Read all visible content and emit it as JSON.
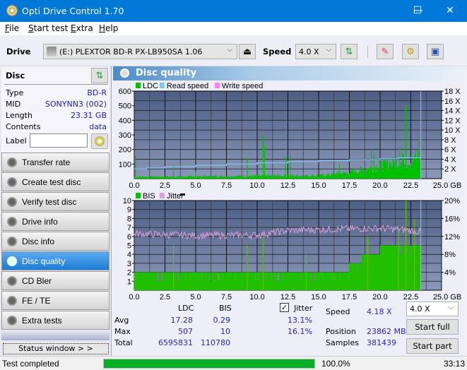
{
  "window": {
    "title": "Opti Drive Control 1.70",
    "minimize": "—",
    "maximize": "☐",
    "close": "✕"
  },
  "menu": [
    {
      "label": "File",
      "u": "F",
      "rest": "ile"
    },
    {
      "label": "Start test",
      "u": "S",
      "rest": "tart test"
    },
    {
      "label": "Extra",
      "u": "E",
      "rest": "xtra"
    },
    {
      "label": "Help",
      "u": "H",
      "rest": "elp"
    }
  ],
  "toolbar": {
    "drive_label": "Drive",
    "drive_value": "(E:)  PLEXTOR BD-R  PX-LB950SA 1.06",
    "speed_label": "Speed",
    "speed_value": "4.0 X"
  },
  "disc": {
    "title": "Disc",
    "rows": [
      {
        "k": "Type",
        "v": "BD-R"
      },
      {
        "k": "MID",
        "v": "SONYNN3 (002)"
      },
      {
        "k": "Length",
        "v": "23.31 GB"
      },
      {
        "k": "Contents",
        "v": "data"
      }
    ],
    "label_key": "Label",
    "label_value": ""
  },
  "nav": [
    {
      "label": "Transfer rate",
      "active": false
    },
    {
      "label": "Create test disc",
      "active": false
    },
    {
      "label": "Verify test disc",
      "active": false
    },
    {
      "label": "Drive info",
      "active": false
    },
    {
      "label": "Disc info",
      "active": false
    },
    {
      "label": "Disc quality",
      "active": true
    },
    {
      "label": "CD Bler",
      "active": false
    },
    {
      "label": "FE / TE",
      "active": false
    },
    {
      "label": "Extra tests",
      "active": false
    }
  ],
  "status_window_button": "Status window > >",
  "panel_title": "Disc quality",
  "colors": {
    "ldc": "#00c000",
    "read": "#7ec8f0",
    "write": "#ff80ff",
    "bis": "#00c000",
    "jitter": "#d8a0d8",
    "progress": "#06b025"
  },
  "chart_data": [
    {
      "type": "area",
      "legend": [
        "LDC",
        "Read speed",
        "Write speed"
      ],
      "x_ticks": [
        "0.0",
        "2.5",
        "5.0",
        "7.5",
        "10.0",
        "12.5",
        "15.0",
        "17.5",
        "20.0",
        "22.5",
        "25.0 GB"
      ],
      "y_ticks_left": [
        "600",
        "500",
        "400",
        "300",
        "200",
        "100"
      ],
      "y_ticks_right": [
        "18 X",
        "16 X",
        "14 X",
        "12 X",
        "10 X",
        "8 X",
        "6 X",
        "4 X",
        "2 X"
      ],
      "xlim": [
        0,
        25
      ],
      "ylim": [
        0,
        600
      ],
      "y2lim": [
        0,
        18
      ],
      "ldc_baseline": [
        [
          0,
          12
        ],
        [
          5,
          14
        ],
        [
          10,
          18
        ],
        [
          15,
          20
        ],
        [
          17.5,
          40
        ],
        [
          20,
          85
        ],
        [
          21.5,
          110
        ],
        [
          23.3,
          120
        ]
      ],
      "ldc_spikes": [
        [
          0.1,
          160
        ],
        [
          3.2,
          95
        ],
        [
          5.0,
          50
        ],
        [
          9.2,
          145
        ],
        [
          10.5,
          300
        ],
        [
          10.6,
          220
        ],
        [
          12.3,
          155
        ],
        [
          12.7,
          160
        ],
        [
          16.7,
          100
        ],
        [
          19.3,
          200
        ],
        [
          19.5,
          165
        ],
        [
          21.6,
          220
        ],
        [
          21.8,
          180
        ],
        [
          22.1,
          507
        ],
        [
          22.9,
          190
        ],
        [
          23.1,
          200
        ],
        [
          23.2,
          300
        ]
      ],
      "read_speed": [
        [
          0,
          2.0
        ],
        [
          1,
          2.2
        ],
        [
          2.5,
          2.45
        ],
        [
          5,
          2.75
        ],
        [
          7.5,
          3.0
        ],
        [
          10,
          3.25
        ],
        [
          12.5,
          3.5
        ],
        [
          15,
          3.7
        ],
        [
          17.5,
          3.9
        ],
        [
          20,
          4.1
        ],
        [
          21.5,
          4.3
        ],
        [
          23.3,
          4.3
        ]
      ],
      "end_position_gb": 23.31
    },
    {
      "type": "area",
      "legend": [
        "BIS",
        "Jitter"
      ],
      "x_ticks": [
        "0.0",
        "2.5",
        "5.0",
        "7.5",
        "10.0",
        "12.5",
        "15.0",
        "17.5",
        "20.0",
        "22.5",
        "25.0 GB"
      ],
      "y_ticks_left": [
        "10",
        "9",
        "8",
        "7",
        "6",
        "5",
        "4",
        "3",
        "2",
        "1"
      ],
      "y_ticks_right": [
        "20%",
        "16%",
        "12%",
        "8%",
        "4%"
      ],
      "xlim": [
        0,
        25
      ],
      "ylim": [
        0,
        10
      ],
      "y2lim": [
        0,
        20
      ],
      "bis_baseline": [
        [
          0,
          2
        ],
        [
          12.5,
          2
        ],
        [
          15,
          2
        ],
        [
          17.5,
          3
        ],
        [
          18.5,
          4
        ],
        [
          20,
          5
        ],
        [
          23.3,
          5
        ]
      ],
      "bis_spikes": [
        [
          3.2,
          5
        ],
        [
          9.2,
          5
        ],
        [
          10.5,
          6
        ],
        [
          14,
          4
        ],
        [
          19,
          6
        ],
        [
          21.5,
          7
        ],
        [
          22.1,
          10
        ],
        [
          22.8,
          8
        ]
      ],
      "jitter_avg_pct": [
        [
          0,
          12.6
        ],
        [
          5,
          12.2
        ],
        [
          10,
          12.3
        ],
        [
          12.5,
          13.3
        ],
        [
          15,
          13.5
        ],
        [
          17.5,
          13.7
        ],
        [
          20,
          13.8
        ],
        [
          22,
          13.5
        ],
        [
          23.3,
          13.0
        ]
      ]
    }
  ],
  "stats": {
    "col_ldc": "LDC",
    "col_bis": "BIS",
    "jitter_label": "Jitter",
    "jitter_checked": true,
    "rows": [
      {
        "label": "Avg",
        "ldc": "17.28",
        "bis": "0.29",
        "jitter": "13.1%"
      },
      {
        "label": "Max",
        "ldc": "507",
        "bis": "10",
        "jitter": "16.1%"
      },
      {
        "label": "Total",
        "ldc": "6595831",
        "bis": "110780",
        "jitter": ""
      }
    ],
    "speed_label": "Speed",
    "speed_value": "4.18 X",
    "position_label": "Position",
    "position_value": "23862 MB",
    "samples_label": "Samples",
    "samples_value": "381439",
    "speed_select": "4.0 X",
    "start_full": "Start full",
    "start_part": "Start part"
  },
  "statusbar": {
    "text": "Test completed",
    "progress_pct": 100.0,
    "progress_text": "100.0%",
    "time": "33:13"
  }
}
